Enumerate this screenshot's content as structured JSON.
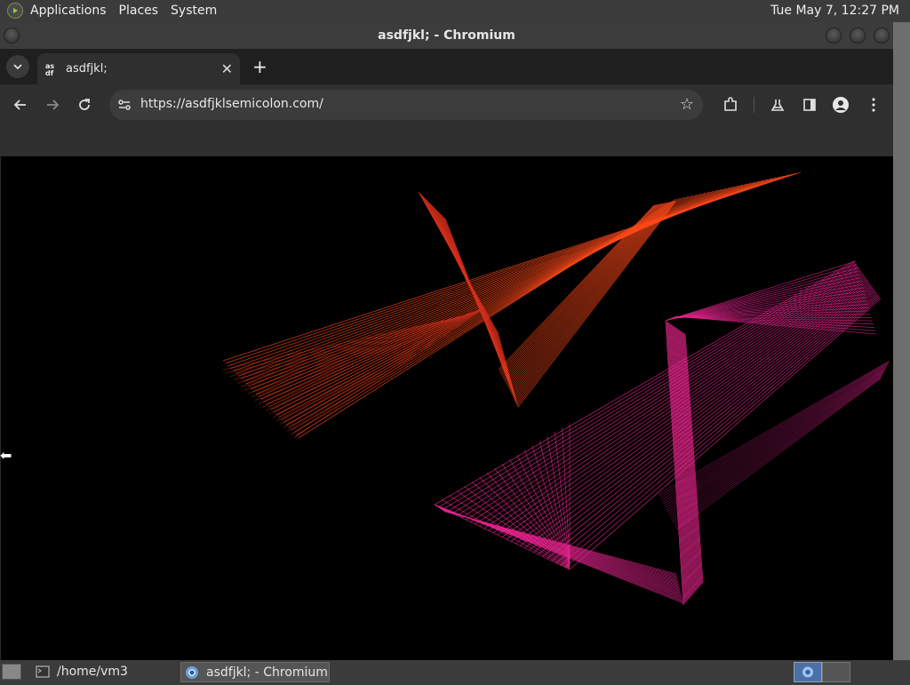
{
  "top_panel": {
    "menus": [
      "Applications",
      "Places",
      "System"
    ],
    "clock": "Tue May  7, 12:27 PM"
  },
  "window": {
    "title": "asdfjkl; - Chromium"
  },
  "browser": {
    "tab_title": "asdfjkl;",
    "tab_favicon_text": "as df",
    "url": "https://asdfjklsemicolon.com/",
    "icons": [
      "back-icon",
      "forward-icon",
      "reload-icon",
      "site-info-icon",
      "star-icon",
      "extensions-icon",
      "labs-icon",
      "side-panel-icon",
      "profile-icon",
      "menu-icon"
    ]
  },
  "page_content": {
    "description_colors": {
      "orange": "#ff4a1a",
      "red": "#d8301c",
      "magenta": "#ff2a9a",
      "pink": "#e0248a"
    }
  },
  "taskbar": {
    "terminal_label": "/home/vm3",
    "chromium_label": "asdfjkl; - Chromium"
  }
}
